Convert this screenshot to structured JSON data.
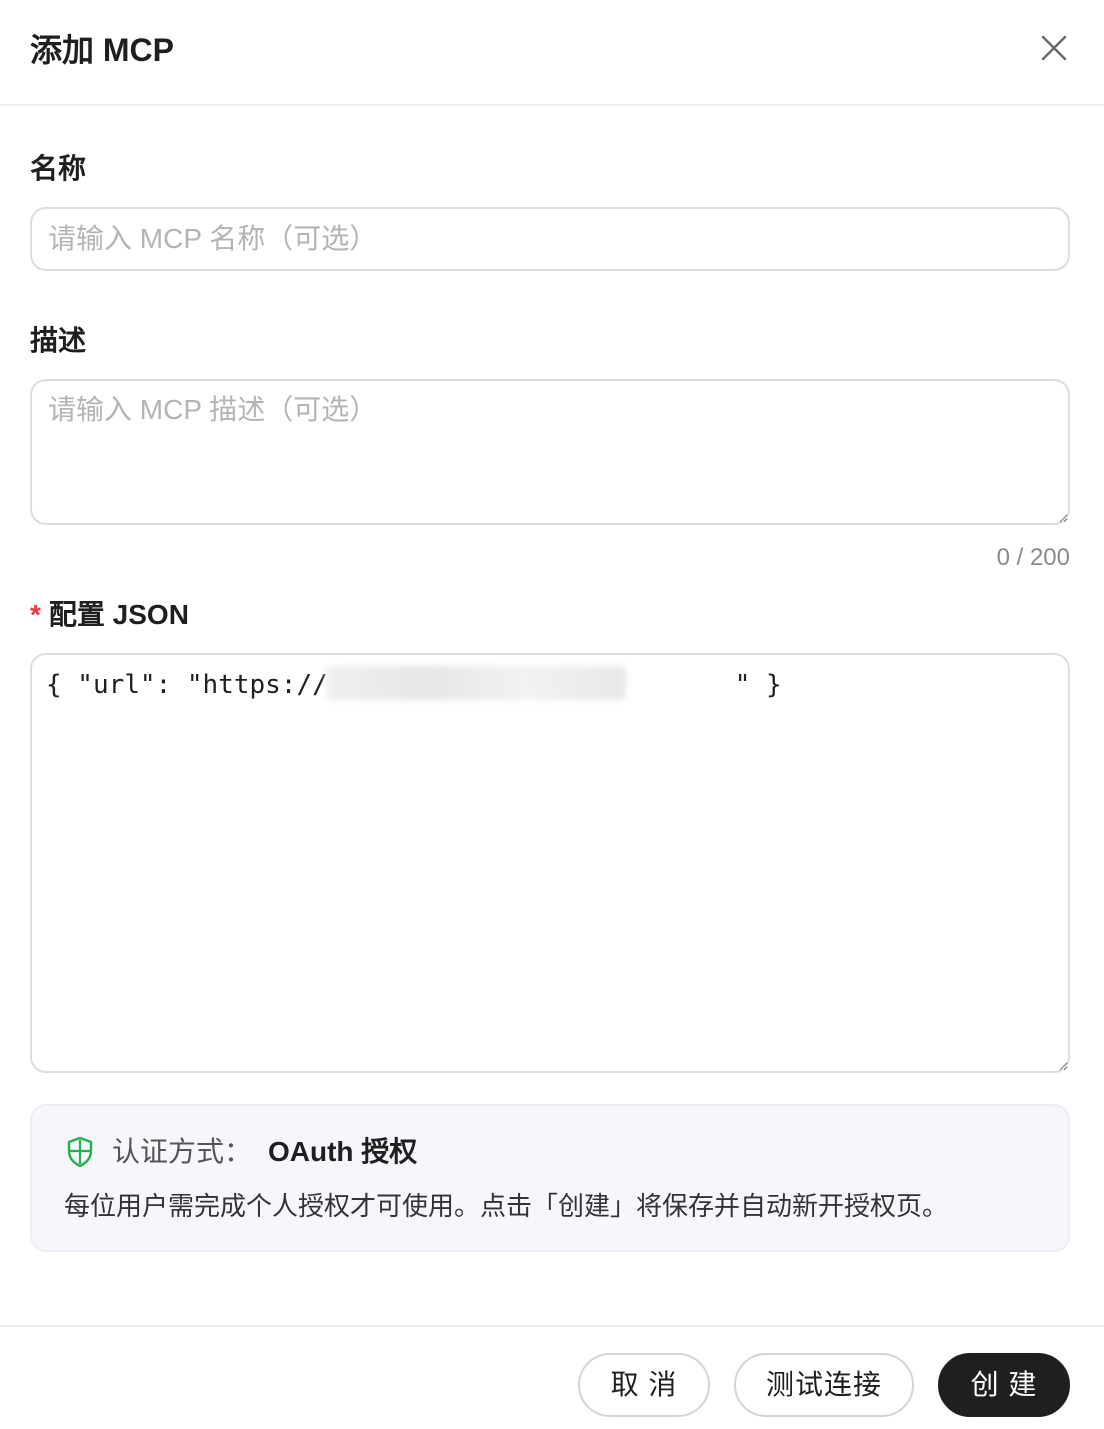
{
  "dialog": {
    "title": "添加 MCP"
  },
  "name_field": {
    "label": "名称",
    "placeholder": "请输入 MCP 名称（可选）",
    "value": ""
  },
  "description_field": {
    "label": "描述",
    "placeholder": "请输入 MCP 描述（可选）",
    "value": "",
    "counter": "0 / 200"
  },
  "config_field": {
    "required_mark": "*",
    "label": "配置 JSON",
    "value": "{ \"url\": \"https://                          \" }"
  },
  "auth": {
    "label": "认证方式：",
    "value": "OAuth 授权",
    "description": "每位用户需完成个人授权才可使用。点击「创建」将保存并自动新开授权页。",
    "icon": "shield-icon",
    "icon_color": "#22b04b"
  },
  "footer": {
    "cancel_label": "取 消",
    "test_label": "测试连接",
    "create_label": "创 建"
  },
  "colors": {
    "primary": "#1f1f1f",
    "required": "#e5393a",
    "border": "#dcdcdc",
    "auth_bg": "#f6f7fc"
  }
}
